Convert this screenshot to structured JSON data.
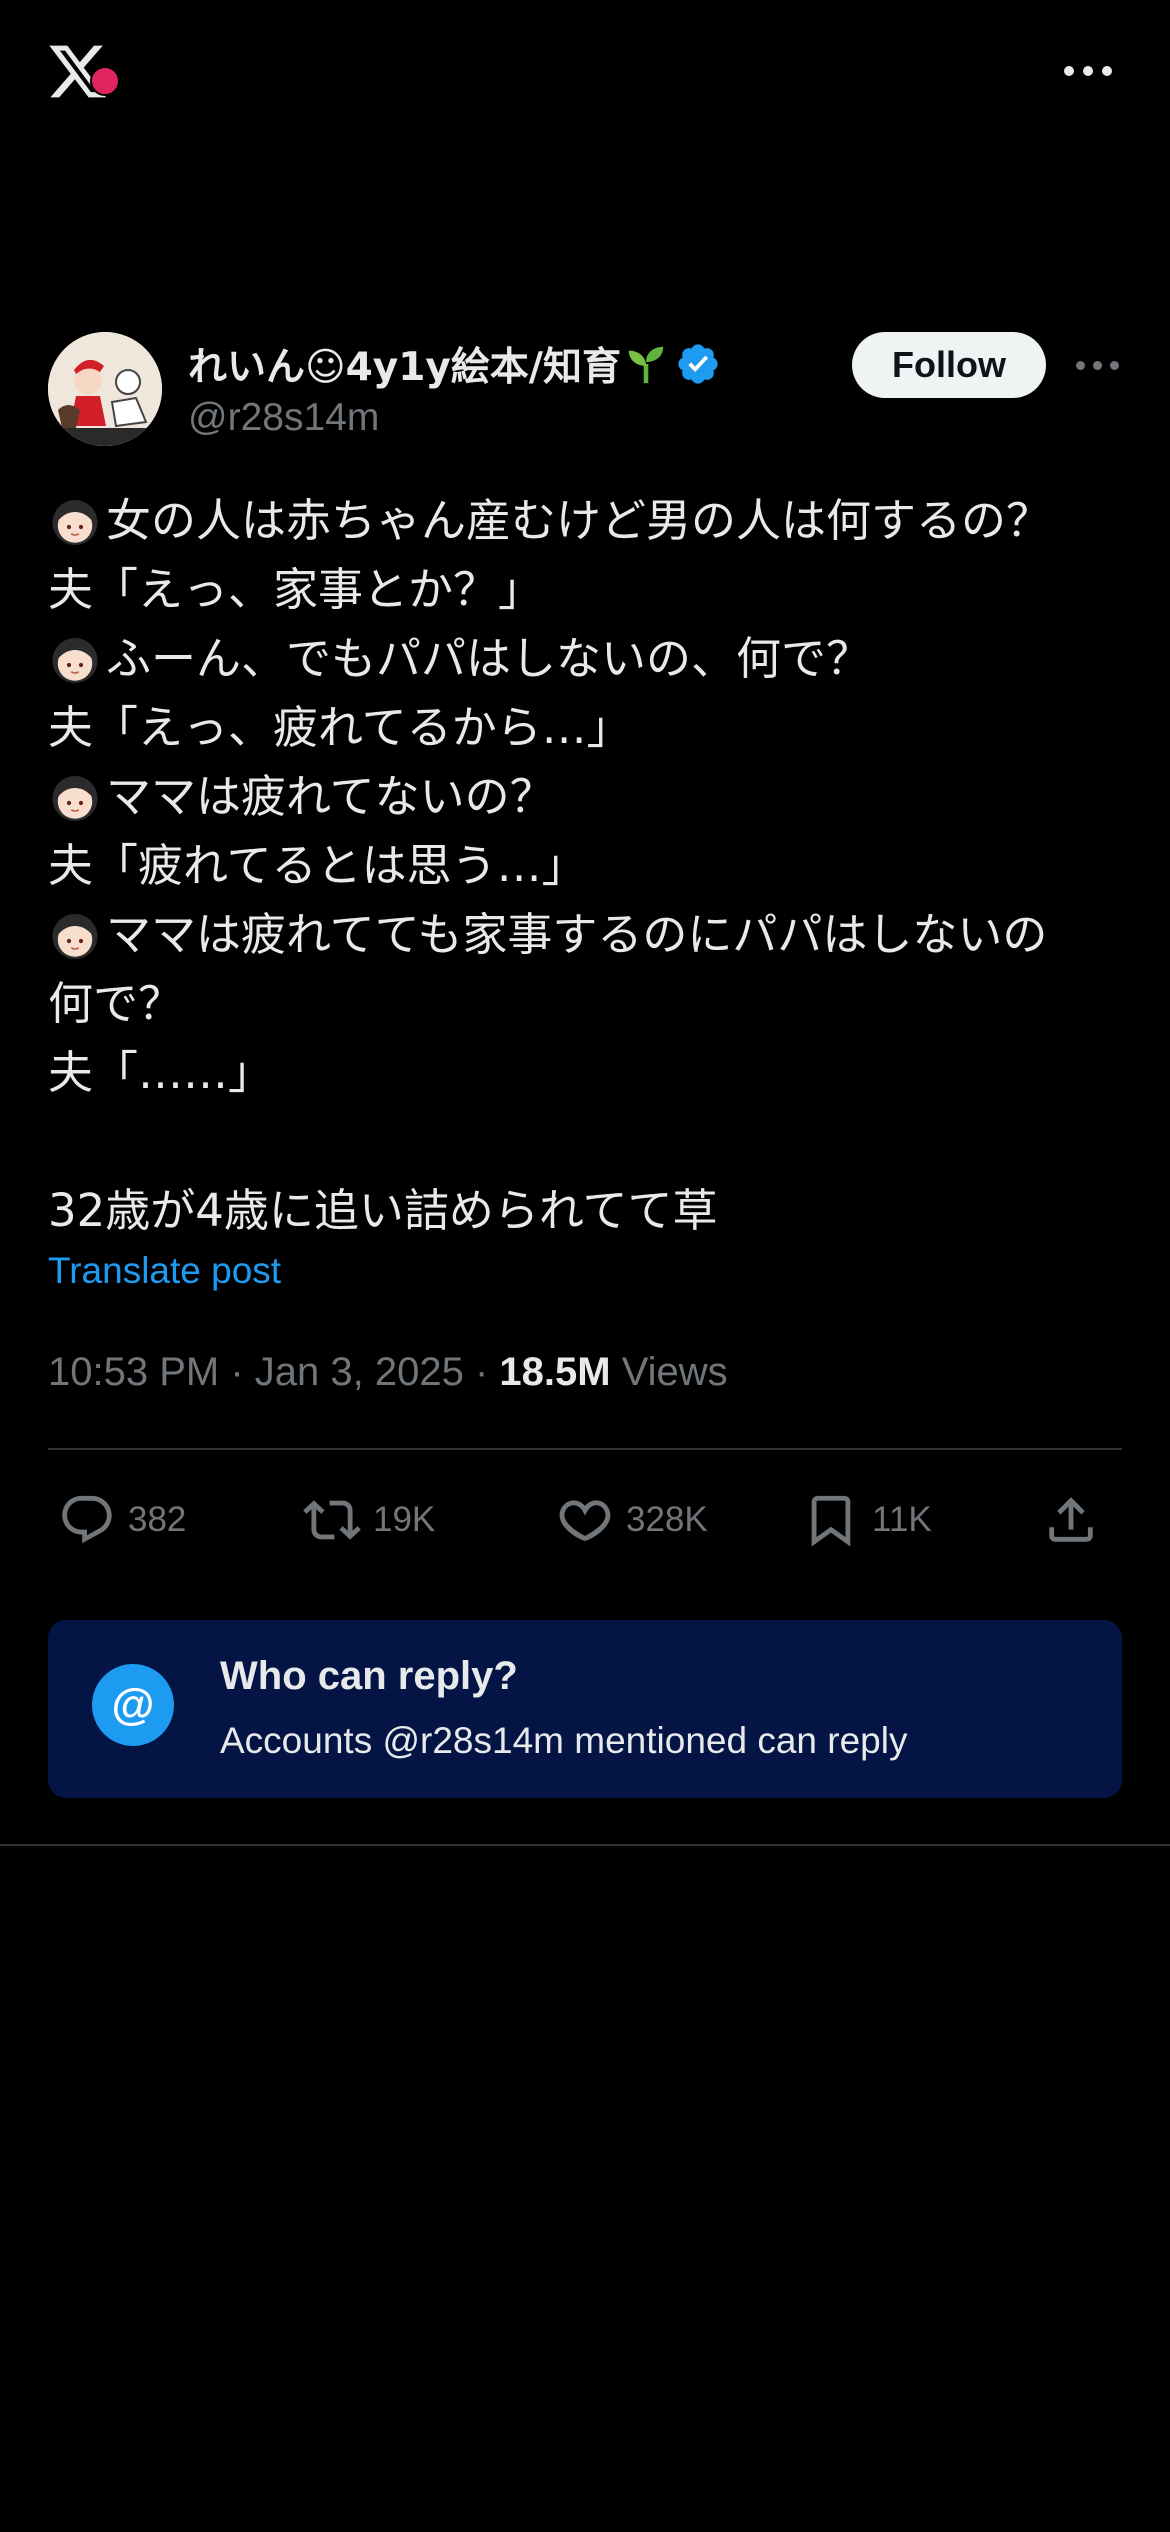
{
  "app": {
    "logo_icon": "x-logo-icon",
    "more_icon": "more-horizontal-icon"
  },
  "post": {
    "author": {
      "display_name": "れいん☺︎4y1y絵本/知育",
      "handle": "@r28s14m",
      "verified": true,
      "follow_label": "Follow"
    },
    "lines": [
      {
        "emoji": true,
        "text": "女の人は赤ちゃん産むけど男の人は何するの？"
      },
      {
        "emoji": false,
        "text": "夫「えっ、家事とか？」"
      },
      {
        "emoji": true,
        "text": "ふーん、でもパパはしないの、何で？"
      },
      {
        "emoji": false,
        "text": "夫「えっ、疲れてるから…」"
      },
      {
        "emoji": true,
        "text": "ママは疲れてないの？"
      },
      {
        "emoji": false,
        "text": "夫「疲れてるとは思う…」"
      },
      {
        "emoji": true,
        "text": "ママは疲れてても家事するのにパパはしないの"
      },
      {
        "emoji": false,
        "text": "何で？"
      },
      {
        "emoji": false,
        "text": "夫「……」"
      },
      {
        "emoji": false,
        "text": ""
      },
      {
        "emoji": false,
        "text": "32歳が4歳に追い詰められてて草"
      }
    ],
    "translate_label": "Translate post",
    "time": "10:53 PM",
    "date": "Jan 3, 2025",
    "views_count": "18.5M",
    "views_label": "Views"
  },
  "actions": {
    "replies": "382",
    "reposts": "19K",
    "likes": "328K",
    "bookmarks": "11K"
  },
  "reply_restriction": {
    "title": "Who can reply?",
    "description": "Accounts @r28s14m mentioned can reply",
    "icon_text": "@"
  },
  "colors": {
    "background": "#000000",
    "accent": "#1d9bf0",
    "muted": "#71767b",
    "card": "#031445"
  }
}
